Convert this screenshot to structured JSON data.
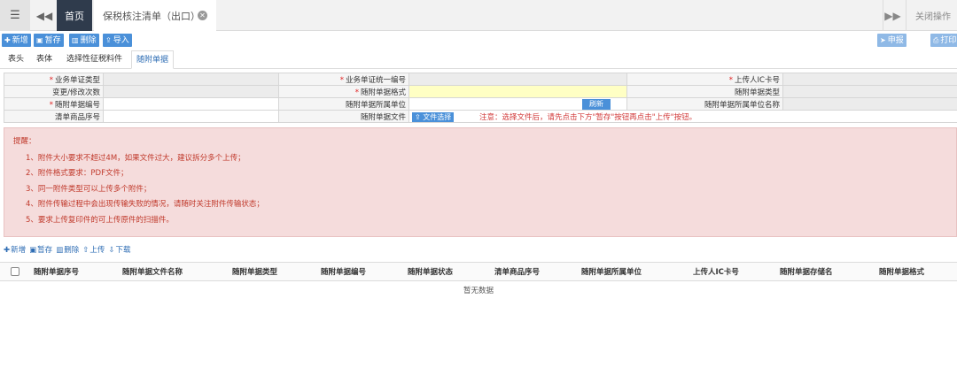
{
  "topbar": {
    "menu_icon": "hamburger-icon",
    "home_tab": "首页",
    "active_tab": "保税核注清单（出口）",
    "close_ops": "关闭操作"
  },
  "toolbar": {
    "new": "新增",
    "save": "暂存",
    "delete": "删除",
    "import": "导入",
    "declare": "申报",
    "print": "打印"
  },
  "subtabs": [
    "表头",
    "表体",
    "选择性征税料件",
    "随附单据"
  ],
  "form": {
    "r1": {
      "l1": "业务单证类型",
      "l2": "业务单证统一编号",
      "l3": "上传人IC卡号"
    },
    "r2": {
      "l1": "变更/修改次数",
      "l2": "随附单据格式",
      "l3": "随附单据类型"
    },
    "r3": {
      "l1": "随附单据编号",
      "l2": "随附单据所属单位",
      "refresh": "刷新",
      "l3": "随附单据所属单位名称"
    },
    "r4": {
      "l1": "清单商品序号",
      "l2": "随附单据文件",
      "file_btn": "文件选择",
      "note": "注意：选择文件后，请先点击下方\"暂存\"按钮再点击\"上传\"按钮。"
    }
  },
  "notice": {
    "title": "提醒：",
    "lines": [
      "1、附件大小要求不超过4M，如果文件过大，建议拆分多个上传；",
      "2、附件格式要求：PDF文件；",
      "3、同一附件类型可以上传多个附件；",
      "4、附件传输过程中会出现传输失败的情况，请随时关注附件传输状态；",
      "5、要求上传复印件的可上传原件的扫描件。"
    ]
  },
  "grid_toolbar": {
    "new": "新增",
    "save": "暂存",
    "delete": "删除",
    "upload": "上传",
    "download": "下载"
  },
  "grid": {
    "columns": [
      "随附单据序号",
      "随附单据文件名称",
      "随附单据类型",
      "随附单据编号",
      "随附单据状态",
      "清单商品序号",
      "随附单据所属单位",
      "上传人IC卡号",
      "随附单据存储名",
      "随附单据格式"
    ],
    "empty_text": "暂无数据"
  }
}
